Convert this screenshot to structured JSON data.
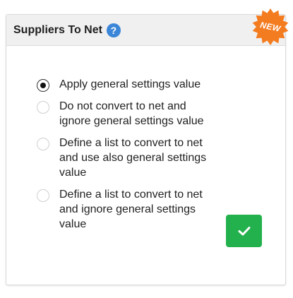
{
  "card": {
    "title": "Suppliers To Net",
    "help_icon": "question-mark-icon",
    "help_glyph": "?",
    "badge": {
      "label": "NEW",
      "color": "#f47c20"
    }
  },
  "options": [
    {
      "label": "Apply general settings value",
      "selected": true
    },
    {
      "label": "Do not convert to net and ignore general settings value",
      "selected": false
    },
    {
      "label": "Define a list to convert to net and use also general settings value",
      "selected": false
    },
    {
      "label": "Define a list to convert to net and ignore general settings value",
      "selected": false
    }
  ],
  "confirm_button": {
    "icon": "checkmark-icon",
    "color": "#22b14c"
  },
  "colors": {
    "help_icon": "#3b86d8",
    "header_bg": "#f0f0f0"
  }
}
